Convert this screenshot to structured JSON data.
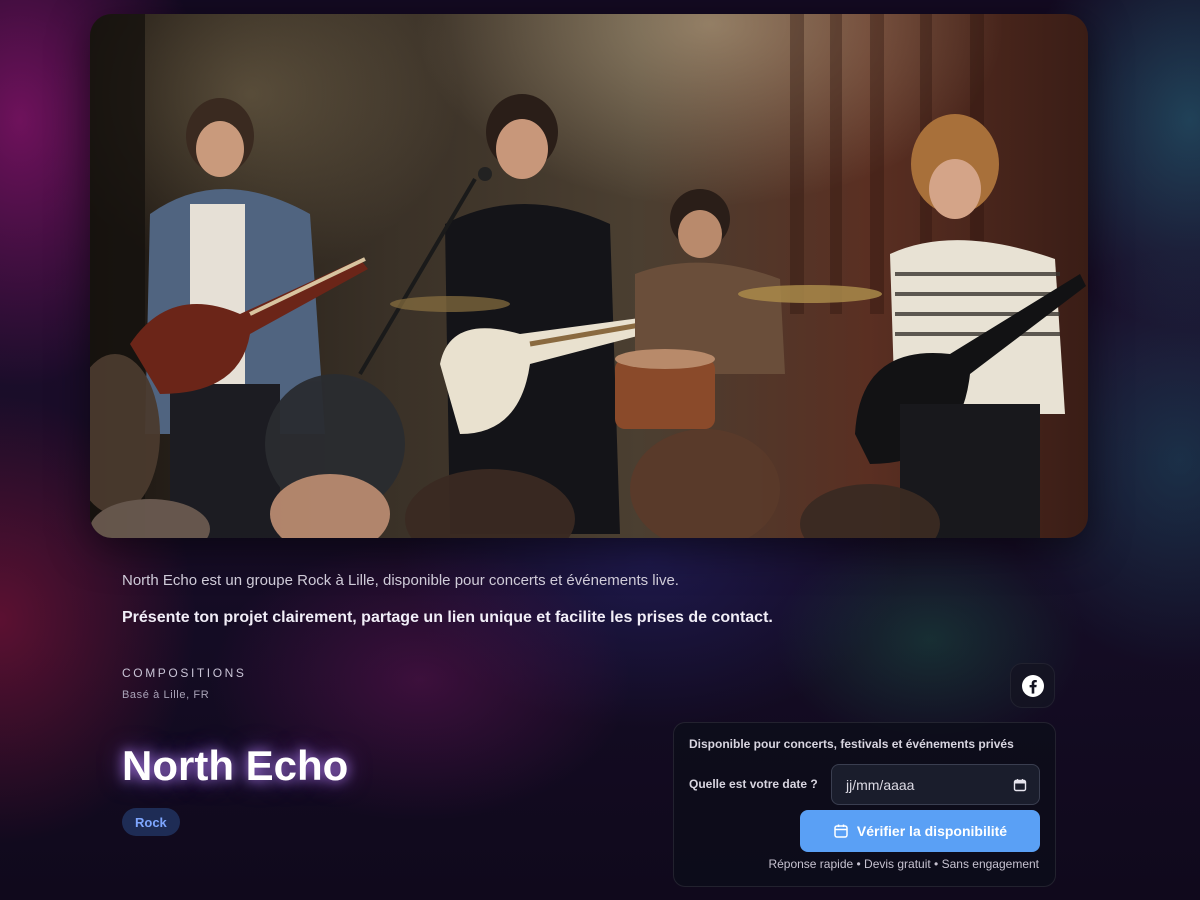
{
  "hero": {
    "image_description": "Photo of a four-piece rock band performing live on a small stage in front of a crowd"
  },
  "intro": {
    "description": "North Echo est un groupe Rock à Lille, disponible pour concerts et événements live.",
    "tagline": "Présente ton projet clairement, partage un lien unique et facilite les prises de contact."
  },
  "profile": {
    "kicker": "COMPOSITIONS",
    "location": "Basé à Lille, FR",
    "name": "North Echo",
    "genre": "Rock"
  },
  "social": {
    "icon": "facebook-icon"
  },
  "availability": {
    "title": "Disponible pour concerts, festivals et événements privés",
    "date_label": "Quelle est votre date ?",
    "date_placeholder": "jj/mm/aaaa",
    "button_label": "Vérifier la disponibilité",
    "footnote": "Réponse rapide • Devis gratuit • Sans engagement"
  },
  "colors": {
    "accent": "#5aa0f5",
    "badge_bg": "#1e2c55",
    "badge_text": "#7ea6ff"
  }
}
